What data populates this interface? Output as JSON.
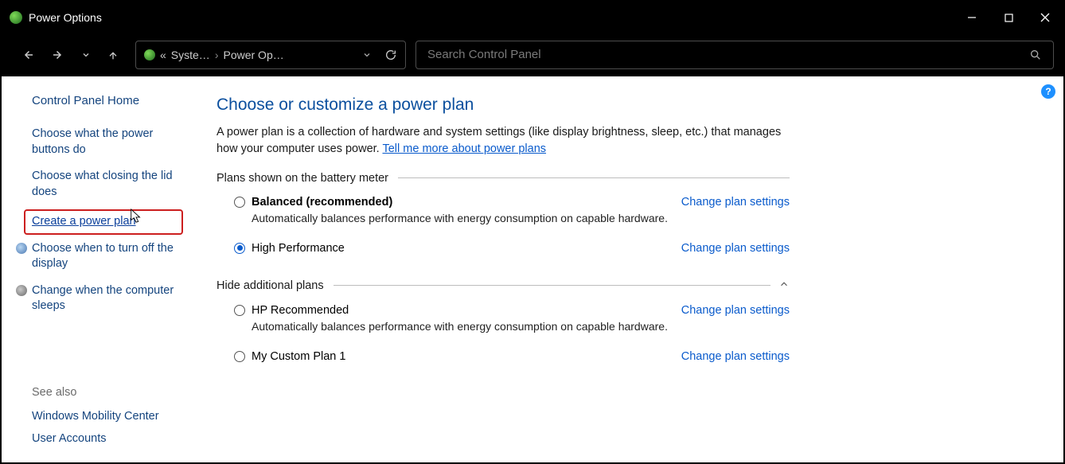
{
  "window": {
    "title": "Power Options"
  },
  "breadcrumb": {
    "prefix": "«",
    "part1": "Syste…",
    "part2": "Power Op…"
  },
  "search": {
    "placeholder": "Search Control Panel"
  },
  "sidebar": {
    "home": "Control Panel Home",
    "items": [
      "Choose what the power buttons do",
      "Choose what closing the lid does",
      "Create a power plan",
      "Choose when to turn off the display",
      "Change when the computer sleeps"
    ],
    "see_also_header": "See also",
    "see_also": [
      "Windows Mobility Center",
      "User Accounts"
    ]
  },
  "main": {
    "title": "Choose or customize a power plan",
    "description": "A power plan is a collection of hardware and system settings (like display brightness, sleep, etc.) that manages how your computer uses power. ",
    "learn_link": "Tell me more about power plans",
    "section1": "Plans shown on the battery meter",
    "section2": "Hide additional plans",
    "change_link": "Change plan settings",
    "plans": [
      {
        "name": "Balanced (recommended)",
        "desc": "Automatically balances performance with energy consumption on capable hardware.",
        "selected": false,
        "bold": true
      },
      {
        "name": "High Performance",
        "desc": "",
        "selected": true,
        "bold": false
      }
    ],
    "additional_plans": [
      {
        "name": "HP Recommended",
        "desc": "Automatically balances performance with energy consumption on capable hardware.",
        "selected": false
      },
      {
        "name": "My Custom Plan 1",
        "desc": "",
        "selected": false
      }
    ]
  },
  "help_icon": "?"
}
